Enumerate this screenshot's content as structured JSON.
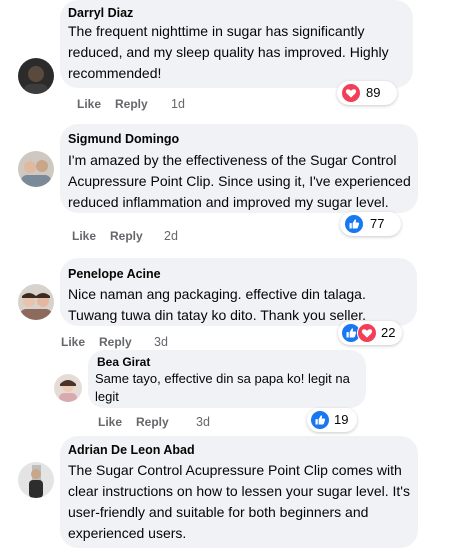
{
  "colors": {
    "bubble": "#f0f2f5",
    "secondary_text": "#65676b",
    "love": "#f33e58",
    "like": "#1877f2"
  },
  "comments": [
    {
      "author": "Darryl Diaz",
      "lines": [
        "The frequent nighttime in sugar has significantly",
        "reduced, and my sleep quality has improved. Highly",
        "recommended!"
      ],
      "like": "Like",
      "reply": "Reply",
      "time": "1d",
      "reactions": {
        "icons": [
          "heart-icon"
        ],
        "count": "89"
      }
    },
    {
      "author": "Sigmund Domingo",
      "lines": [
        "I'm amazed by the effectiveness of the Sugar Control",
        "Acupressure Point Clip. Since using it, I've experienced",
        "reduced inflammation and improved my sugar level."
      ],
      "like": "Like",
      "reply": "Reply",
      "time": "2d",
      "reactions": {
        "icons": [
          "thumbs-up-icon"
        ],
        "count": "77"
      }
    },
    {
      "author": "Penelope Acine",
      "lines": [
        "Nice naman ang packaging. effective din talaga.",
        "Tuwang tuwa din tatay ko dito. Thank you seller."
      ],
      "like": "Like",
      "reply": "Reply",
      "time": "3d",
      "reactions": {
        "icons": [
          "thumbs-up-icon",
          "heart-icon"
        ],
        "count": "22"
      }
    },
    {
      "author": "Bea Girat",
      "lines": [
        "Same tayo, effective din sa papa ko! legit na",
        "legit"
      ],
      "like": "Like",
      "reply": "Reply",
      "time": "3d",
      "reactions": {
        "icons": [
          "thumbs-up-icon"
        ],
        "count": "19"
      }
    },
    {
      "author": "Adrian De Leon Abad",
      "lines": [
        "The Sugar Control Acupressure Point Clip comes with",
        "clear instructions on how to lessen your sugar level. It's",
        "user-friendly and suitable for both beginners and",
        "experienced users."
      ]
    }
  ]
}
